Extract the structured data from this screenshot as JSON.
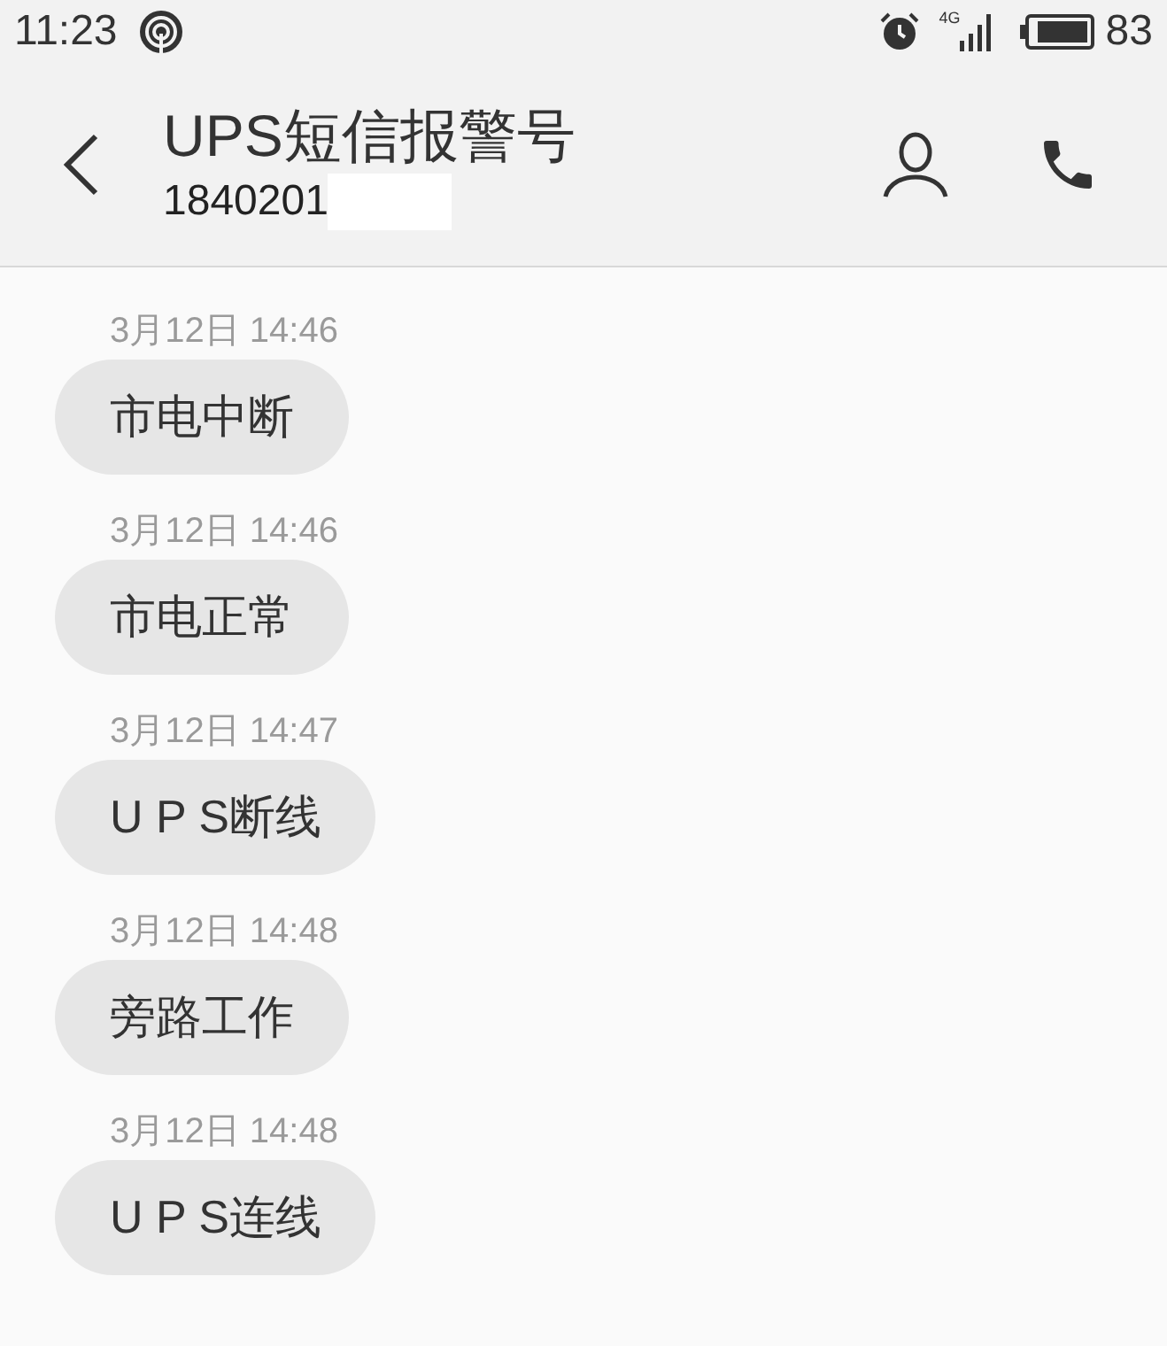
{
  "status_bar": {
    "time": "11:23",
    "network": "4G",
    "battery": "83"
  },
  "header": {
    "title": "UPS短信报警号",
    "number": "1840201"
  },
  "messages": [
    {
      "timestamp": "3月12日 14:46",
      "text": "市电中断"
    },
    {
      "timestamp": "3月12日 14:46",
      "text": "市电正常"
    },
    {
      "timestamp": "3月12日 14:47",
      "text": "U P S断线"
    },
    {
      "timestamp": "3月12日 14:48",
      "text": "旁路工作"
    },
    {
      "timestamp": "3月12日 14:48",
      "text": "U P S连线"
    }
  ]
}
